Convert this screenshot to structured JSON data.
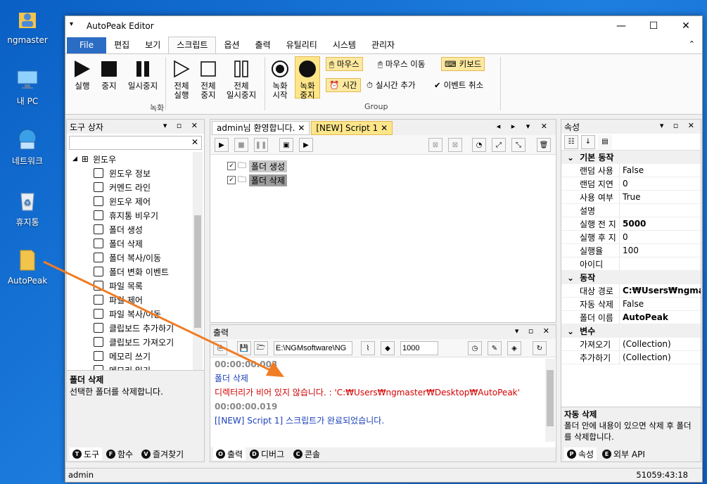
{
  "desktop": {
    "icons": [
      {
        "label": "ngmaster"
      },
      {
        "label": "내 PC"
      },
      {
        "label": "네트워크"
      },
      {
        "label": "휴지통"
      },
      {
        "label": "AutoPeak"
      }
    ]
  },
  "window": {
    "title": "AutoPeak Editor",
    "quick_access": "▾",
    "minimize": "—",
    "maximize": "☐",
    "close": "✕"
  },
  "menu": {
    "tabs": [
      "File",
      "편집",
      "보기",
      "스크립트",
      "옵션",
      "출력",
      "유틸리티",
      "시스템",
      "관리자"
    ],
    "active": "스크립트",
    "collapse": "⌃"
  },
  "ribbon": {
    "record_group_label": "녹화",
    "group_label": "Group",
    "buttons": {
      "run": "실행",
      "stop": "중지",
      "pause": "일시중지",
      "run_all_1": "전체",
      "run_all_2": "실행",
      "stop_all_1": "전체",
      "stop_all_2": "중지",
      "pause_all_1": "전체",
      "pause_all_2": "일시중지",
      "rec_start_1": "녹화",
      "rec_start_2": "시작",
      "rec_stop_1": "녹화",
      "rec_stop_2": "중지"
    },
    "toggles": {
      "mouse": "마우스",
      "mouse_move": "마우스 이동",
      "keyboard": "키보드",
      "time": "시간",
      "realtime_add": "실시간 추가",
      "event_cancel": "이벤트 취소"
    }
  },
  "toolbox": {
    "title": "도구 상자",
    "search_value": "",
    "category": "윈도우",
    "items": [
      "윈도우 정보",
      "커멘드 라인",
      "윈도우 제어",
      "휴지통 비우기",
      "폴더 생성",
      "폴더 삭제",
      "폴더 복사/이동",
      "폴더 변화 이벤트",
      "파일 목록",
      "파일 제어",
      "파일 복사/이동",
      "클립보드 추가하기",
      "클립보드 가져오기",
      "메모리 쓰기",
      "메모리 읽기"
    ],
    "desc_title": "폴더 삭제",
    "desc_text": "선택한 폴더를 삭제합니다.",
    "bottom_tabs": [
      "도구",
      "함수",
      "즐겨찾기"
    ]
  },
  "editor": {
    "tabs": [
      "admin님 환영합니다.",
      "[NEW] Script 1"
    ],
    "script_items": [
      "폴더 생성",
      "폴더 삭제"
    ]
  },
  "output": {
    "title": "출력",
    "path": "E:\\NGMsoftware\\NG",
    "count": "1000",
    "lines": [
      {
        "text": "00:00:00.003",
        "color": "#888888",
        "bold": true
      },
      {
        "text": "폴더 삭제",
        "color": "#1a3fb8",
        "bold": false
      },
      {
        "text": "디렉터리가 비어 있지 않습니다. : 'C:₩Users₩ngmaster₩Desktop₩AutoPeak'",
        "color": "#d40000",
        "bold": false
      },
      {
        "text": "00:00:00.019",
        "color": "#888888",
        "bold": true
      },
      {
        "text": "[[NEW] Script 1] 스크립트가 완료되었습니다.",
        "color": "#1a3fb8",
        "bold": false
      }
    ],
    "bottom_tabs": [
      "출력",
      "디버그",
      "콘솔"
    ]
  },
  "properties": {
    "title": "속성",
    "categories": [
      {
        "name": "기본 동작",
        "rows": [
          {
            "k": "랜덤 사용",
            "v": "False",
            "b": false
          },
          {
            "k": "랜덤 지연",
            "v": "0",
            "b": false
          },
          {
            "k": "사용 여부",
            "v": "True",
            "b": false
          },
          {
            "k": "설명",
            "v": "",
            "b": false
          },
          {
            "k": "실행 전 지",
            "v": "5000",
            "b": true
          },
          {
            "k": "실행 후 지",
            "v": "0",
            "b": false
          },
          {
            "k": "실행율",
            "v": "100",
            "b": false
          },
          {
            "k": "아이디",
            "v": "",
            "b": false
          }
        ]
      },
      {
        "name": "동작",
        "rows": [
          {
            "k": "대상 경로",
            "v": "C:₩Users₩ngmaste",
            "b": true
          },
          {
            "k": "자동 삭제",
            "v": "False",
            "b": false
          },
          {
            "k": "폴더 이름",
            "v": "AutoPeak",
            "b": true
          }
        ]
      },
      {
        "name": "변수",
        "rows": [
          {
            "k": "가져오기",
            "v": "(Collection)",
            "b": false
          },
          {
            "k": "추가하기",
            "v": "(Collection)",
            "b": false
          }
        ]
      }
    ],
    "desc_title": "자동 삭제",
    "desc_text": "폴더 안에 내용이 있으면 삭제 후 폴더를 삭제합니다.",
    "bottom_tabs": [
      "속성",
      "외부 API"
    ]
  },
  "status": {
    "user": "admin",
    "clock": "51059:43:18"
  },
  "colors": {
    "accent": "#2b6cc4",
    "highlight": "#fde9a0",
    "arrow": "#f07c24",
    "active_tab": "#fde68a"
  }
}
